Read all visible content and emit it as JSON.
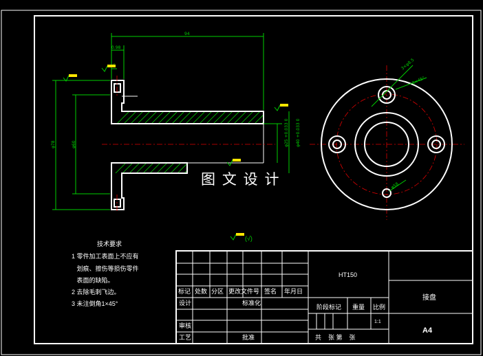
{
  "drawing": {
    "title_watermark": "图 文 设 计",
    "roughness_note": "(√)",
    "dimensions": {
      "overall_length": "94",
      "flange_width_a": "0.98",
      "flange_width_b": "6",
      "dia_outer": "φ78",
      "dia_pcd": "φ60",
      "dia_bore_25": "φ25 +0.033 0",
      "dia_bore_40": "φ40 +0.033 0",
      "hole_note": "3×φ8.5",
      "hole_note_b": "2×45°",
      "hole_note_c": "φ58"
    }
  },
  "tech_requirements": {
    "heading": "技术要求",
    "items": [
      "1  零件加工表面上不应有",
      "   划痕、擦伤等损伤零件",
      "   表面的缺陷。",
      "2  去除毛刺飞边。",
      "3  未注倒角1×45°"
    ]
  },
  "title_block": {
    "material": "HT150",
    "part_name": "接盘",
    "sheet_size": "A4",
    "scale": "1:1",
    "headers": [
      "标记",
      "处数",
      "分区",
      "更改文件号",
      "签名",
      "年月日"
    ],
    "design_label": "设计",
    "standardize_label": "标准化",
    "stage_mark_label": "阶段标记",
    "weight_label": "重量",
    "scale_label": "比例",
    "review_label": "审核",
    "process_label": "工艺",
    "approve_label": "批准",
    "sheets_label": "共    张 第    张"
  }
}
